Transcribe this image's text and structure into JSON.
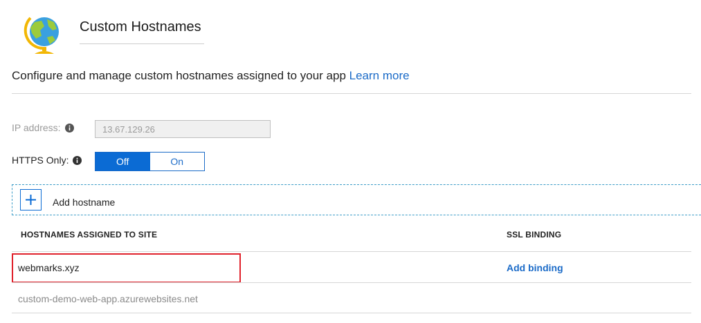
{
  "header": {
    "title": "Custom Hostnames",
    "icon": "globe-icon"
  },
  "description": {
    "text": "Configure and manage custom hostnames assigned to your app",
    "link_label": "Learn more"
  },
  "settings": {
    "ip_label": "IP address:",
    "ip_value": "13.67.129.26",
    "https_label": "HTTPS Only:",
    "https_options": [
      "Off",
      "On"
    ],
    "https_selected": "Off"
  },
  "add_hostname": {
    "label": "Add hostname"
  },
  "table": {
    "columns": [
      "HOSTNAMES ASSIGNED TO SITE",
      "SSL BINDING"
    ],
    "rows": [
      {
        "hostname": "webmarks.xyz",
        "binding_action": "Add binding"
      },
      {
        "hostname": "custom-demo-web-app.azurewebsites.net",
        "binding_action": ""
      }
    ]
  },
  "colors": {
    "accent": "#0b6bd4",
    "link": "#1b6bc8",
    "highlight": "#e0212b"
  }
}
